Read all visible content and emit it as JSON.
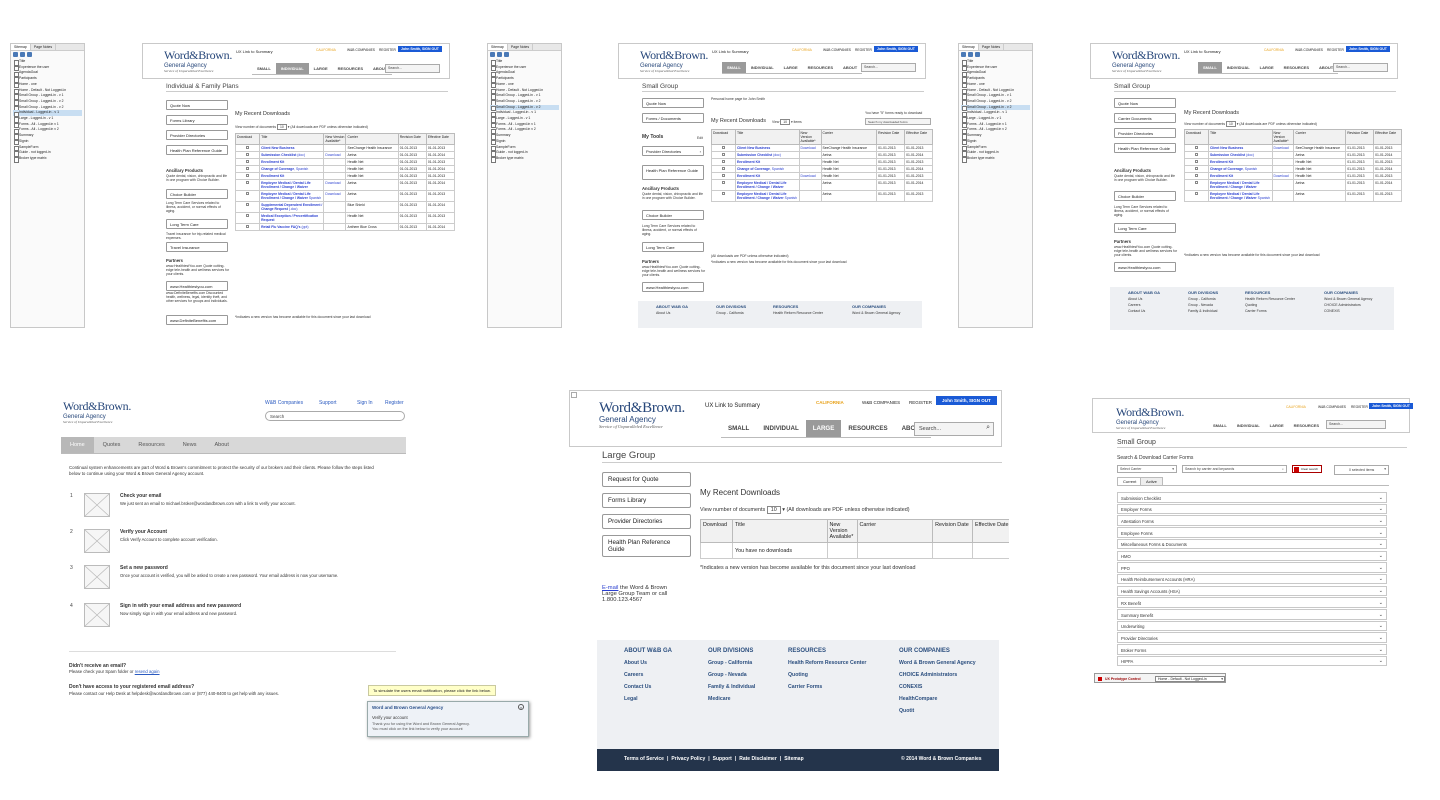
{
  "sitemap": {
    "tabs": [
      "Sitemap",
      "Page Notes"
    ],
    "items": [
      "Title",
      "Experience the user",
      "AgendaGoal",
      "Participants",
      "Home - one",
      "Home - Default - Not Logged-in",
      "Small Group - Logged-in - v 1",
      "Small Group - Logged-in - v 2",
      "Small Group - Logged-in - v 2",
      "Individual - Logged-in - v 1",
      "Large - Logged-in - v 1",
      "Forms - All - Logged-in v 1",
      "Forms - All - Logged-in v 2",
      "Summary",
      "Signin",
      "SampleForm",
      "Guide - not logged-in",
      "Broker type matrix"
    ],
    "selected_p1": "Individual - Logged-in - v 1",
    "selected_p2": "Small Group - Logged-in - v 2",
    "selected_p3": "Small Group - Logged-in - v 2"
  },
  "header": {
    "logo_line1": "Word&Brown.",
    "logo_line2": "General Agency",
    "logo_line3": "Service of Unparalleled Excellence",
    "ux_link": "UX  Link to Summary",
    "state": "CALIFORNIA",
    "companies": "W&B COMPANIES",
    "register": "REGISTER",
    "user_btn": "John Smith, SIGN OUT",
    "search_placeholder": "Search...",
    "nav": [
      "SMALL",
      "INDIVIDUAL",
      "LARGE",
      "RESOURCES",
      "ABOUT"
    ]
  },
  "panel1": {
    "title": "Individual & Family Plans",
    "side_buttons": [
      "Quote Now",
      "Forms Library",
      "Provider Directories",
      "Health Plan Reference Guide"
    ],
    "ancillary_title": "Ancillary Products",
    "ancillary_desc": "Quote dental, vision, chiropractic and life in one program with Choice Builder.",
    "choice_builder": "Choice Builder",
    "ltc_desc": "Long Term Care Services related to illness, accident, or normal effects of aging.",
    "ltc_btn": "Long Term Care",
    "travel_desc": "Travel insurance for trip-related medical expenses.",
    "travel_btn": "Travel Insurance",
    "partners_title": "Partners",
    "partners_desc": "www.HealthiestYou.com Quote cutting-edge tele-health and wellness services for your clients.",
    "partner_btn1": "www.Healthiestyou.com",
    "partners_desc2": "www.DefiniteBenefits.com Discounted health, wellness, legal, identity theft, and other services for groups and individuals.",
    "partner_btn2": "www.DefiniteBenefits.com",
    "downloads_title": "My Recent Downloads",
    "view_label": "View number of documents",
    "view_value": "10",
    "pdf_note": "(All downloads are PDF unless otherwise indicated)",
    "footnote": "*Indicates a new version has become available for this document since your last download"
  },
  "table_headers": [
    "Download",
    "Title",
    "New Version Available*",
    "Carrier",
    "Revision Date",
    "Effective Date"
  ],
  "rows_p1": [
    {
      "title": "Client New Business",
      "extra": "",
      "dl": "",
      "carrier": "SeeChange Health Insurance",
      "rev": "01-01-2013",
      "eff": "01-01-2013"
    },
    {
      "title": "Submission Checklist",
      "extra": " (doc)",
      "dl": "Download",
      "carrier": "Aetna",
      "rev": "01-01-2013",
      "eff": "01-01-2014"
    },
    {
      "title": "Enrollment Kit",
      "extra": "",
      "dl": "",
      "carrier": "Health Net",
      "rev": "01-01-2013",
      "eff": "01-01-2013"
    },
    {
      "title": "Change of Coverage",
      "extra": ", Spanish",
      "dl": "",
      "carrier": "Health Net",
      "rev": "01-01-2013",
      "eff": "01-01-2014"
    },
    {
      "title": "Enrollment Kit",
      "extra": "",
      "dl": "",
      "carrier": "Health Net",
      "rev": "01-01-2013",
      "eff": "01-01-2013"
    },
    {
      "title": "Employee Medical / Dental Life Enrollment / Change / Waiver",
      "extra": "",
      "dl": "Download",
      "carrier": "Aetna",
      "rev": "01-01-2013",
      "eff": "01-01-2014"
    },
    {
      "title": "Employee Medical / Dental Life Enrollment / Change / Waiver",
      "extra": " Spanish",
      "dl": "Download",
      "carrier": "Aetna",
      "rev": "01-01-2013",
      "eff": "01-01-2013"
    },
    {
      "title": "Supplemental Dependent Enrollment / Change Request",
      "extra": " (.doc)",
      "dl": "",
      "carrier": "Blue Shield",
      "rev": "01-01-2013",
      "eff": "01-01-2014"
    },
    {
      "title": "Medical Exception / Precertification Request",
      "extra": "",
      "dl": "",
      "carrier": "Health Net",
      "rev": "01-01-2013",
      "eff": "01-01-2013"
    },
    {
      "title": "Retail Flu Vaccine FAQ's",
      "extra": " (ppt)",
      "dl": "",
      "carrier": "Anthem Blue Cross",
      "rev": "01-01-2013",
      "eff": "01-01-2014"
    }
  ],
  "panel2": {
    "title": "Small Group",
    "personal": "Personal home page for John Smith",
    "forms_ready": "You have \"5\" forms ready to download",
    "search_downloads": "Search my downloaded forms",
    "side_buttons": [
      "Quote Now",
      "Forms / Documents"
    ],
    "my_tools": "My Tools",
    "edit": "Edit",
    "tool_buttons": [
      "Provider Directories",
      "Health Plan Reference Guide"
    ],
    "ancillary_title": "Ancillary Products",
    "ancillary_desc": "Quote dental, vision, chiropractic and life in one program with Choice Builder.",
    "choice_builder": "Choice Builder",
    "ltc_desc": "Long Term Care Services related to illness, accident, or normal effects of aging.",
    "ltc_btn": "Long Term Care",
    "partners_title": "Partners",
    "partners_desc": "www.HealthiestYou.com Quote cutting-edge tele-health and wellness services for your clients.",
    "partner_btn": "www.Healthiestyou.com",
    "downloads_title": "My Recent Downloads",
    "view_label": "View",
    "view_value": "10",
    "items_label": "items",
    "pdf_note": "(All downloads are PDF unless otherwise indicated)",
    "footnote": "*Indicates a new version has become available for this document since your last download"
  },
  "rows_p2": [
    {
      "title": "Client New Business",
      "extra": "",
      "dl": "Download",
      "carrier": "SeeChange Health Insurance",
      "rev": "01-01-2013",
      "eff": "01-01-2013"
    },
    {
      "title": "Submission Checklist",
      "extra": " (doc)",
      "dl": "",
      "carrier": "Aetna",
      "rev": "01-01-2013",
      "eff": "01-01-2014"
    },
    {
      "title": "Enrollment Kit",
      "extra": "",
      "dl": "",
      "carrier": "Health Net",
      "rev": "01-01-2013",
      "eff": "01-01-2013"
    },
    {
      "title": "Change of Coverage",
      "extra": ", Spanish",
      "dl": "",
      "carrier": "Health Net",
      "rev": "01-01-2013",
      "eff": "01-01-2014"
    },
    {
      "title": "Enrollment Kit",
      "extra": "",
      "dl": "Download",
      "carrier": "Health Net",
      "rev": "01-01-2013",
      "eff": "01-01-2013"
    },
    {
      "title": "Employee Medical / Dental Life Enrollment / Change / Waiver",
      "extra": "",
      "dl": "",
      "carrier": "Aetna",
      "rev": "01-01-2013",
      "eff": "01-01-2014"
    },
    {
      "title": "Employee Medical / Dental Life Enrollment / Change / Waiver",
      "extra": " Spanish",
      "dl": "",
      "carrier": "Aetna",
      "rev": "01-01-2013",
      "eff": "01-01-2013"
    }
  ],
  "panel3": {
    "title": "Small Group",
    "side_buttons": [
      "Quote Now",
      "Carrier Documents",
      "Provider Directories",
      "Health Plan Reference Guide"
    ],
    "ancillary_title": "Ancillary Products",
    "ancillary_desc": "Quote dental, vision, chiropractic and life in one program with Choice Builder.",
    "choice_builder": "Choice Builder",
    "ltc_desc": "Long Term Care Services related to illness, accident, or normal effects of aging.",
    "ltc_btn": "Long Term Care",
    "partners_title": "Partners",
    "partners_desc": "www.HealthiestYou.com Quote cutting-edge tele-health and wellness services for your clients.",
    "partner_btn": "www.Healthiestyou.com",
    "downloads_title": "My Recent Downloads",
    "view_label": "View number of documents",
    "view_value": "10",
    "pdf_note": "(All downloads are PDF unless otherwise indicated)",
    "footnote": "*Indicates a new version has become available for this document since your last download"
  },
  "rows_p3": [
    {
      "title": "Client New Business",
      "extra": "",
      "dl": "Download",
      "carrier": "SeeChange Health Insurance",
      "rev": "01-01-2013",
      "eff": "01-01-2013"
    },
    {
      "title": "Submission Checklist",
      "extra": " (doc)",
      "dl": "",
      "carrier": "Aetna",
      "rev": "01-01-2013",
      "eff": "01-01-2014"
    },
    {
      "title": "Enrollment Kit",
      "extra": "",
      "dl": "",
      "carrier": "Health Net",
      "rev": "01-01-2013",
      "eff": "01-01-2013"
    },
    {
      "title": "Change of Coverage",
      "extra": ", Spanish",
      "dl": "",
      "carrier": "Health Net",
      "rev": "01-01-2013",
      "eff": "01-01-2014"
    },
    {
      "title": "Enrollment Kit",
      "extra": "",
      "dl": "Download",
      "carrier": "Health Net",
      "rev": "01-01-2013",
      "eff": "01-01-2013"
    },
    {
      "title": "Employee Medical / Dental Life Enrollment / Change / Waiver",
      "extra": "",
      "dl": "",
      "carrier": "Aetna",
      "rev": "01-01-2013",
      "eff": "01-01-2014"
    },
    {
      "title": "Employee Medical / Dental Life Enrollment / Change / Waiver",
      "extra": " Spanish",
      "dl": "",
      "carrier": "Aetna",
      "rev": "01-01-2013",
      "eff": "01-01-2013"
    }
  ],
  "small_footer": {
    "cols": [
      {
        "h": "ABOUT W&B GA",
        "items": [
          "About Us",
          "Careers",
          "Contact Us"
        ]
      },
      {
        "h": "OUR DIVISIONS",
        "items": [
          "Group - California",
          "Group - Nevada",
          "Family & Individual"
        ]
      },
      {
        "h": "RESOURCES",
        "items": [
          "Health Reform Resource Center",
          "Quoting",
          "Carrier Forms"
        ]
      },
      {
        "h": "OUR COMPANIES",
        "items": [
          "Word & Brown General Agency",
          "CHOICE Administrators",
          "CONEXIS"
        ]
      }
    ]
  },
  "verify": {
    "top_links": [
      "W&B Companies",
      "Support",
      "Sign In",
      "Register"
    ],
    "search_placeholder": "Search",
    "nav": [
      "Home",
      "Quotes",
      "Resources",
      "News",
      "About"
    ],
    "intro": "Continual system enhancements are part of Word & Brown's commitment to protect the security of our brokers and their clients. Please follow the steps listed below to continue using your Word & Brown General Agency account.",
    "steps": [
      {
        "num": "1",
        "title": "Check your email",
        "desc": "We just sent an email to michael.broker@wordandbrown.com with a link to verify your account."
      },
      {
        "num": "2",
        "title": "Verify your Account",
        "desc": "Click Verify Account to complete account verification."
      },
      {
        "num": "3",
        "title": "Set a new password",
        "desc": "Once your account is verified, you will be asked to create a new password. Your email address is now your username."
      },
      {
        "num": "4",
        "title": "Sign in with your email address and new password",
        "desc": "Now simply sign in with your email address and new password."
      }
    ],
    "no_email_title": "Didn't receive an email?",
    "no_email_desc": "Please check your Spam folder or ",
    "resend": "resend again",
    "no_access_title": "Don't have access to your registered email address?",
    "no_access_desc": "Please contact our Help Desk at helpdesk@wordandbrown.com or (877) 440-8400 to get help with any issues.",
    "tooltip": "To simulate the users email notification, please click the link below.",
    "notif_title": "Word and Brown General Agency",
    "notif_subject": "Verify your account",
    "notif_body1": "Thank you for using the Word and Brown General Agency.",
    "notif_body2": "You must click on the link below to verify your account"
  },
  "large": {
    "title": "Large Group",
    "side_buttons": [
      "Request for Quote",
      "Forms Library",
      "Provider Directories",
      "Health Plan Reference Guide"
    ],
    "downloads_title": "My Recent Downloads",
    "view_label": "View number of documents",
    "view_value": "10",
    "pdf_note": "(All downloads are PDF unless otherwise indicated)",
    "empty": "You have no downloads",
    "footnote": "*Indicates a new version has become available for this document since your last download",
    "email_link": "E-mail",
    "contact1": " the Word & Brown",
    "contact2": "Large Group Team or call",
    "contact3": "1.800.123.4567",
    "footer_cols": [
      {
        "h": "ABOUT W&B GA",
        "items": [
          "About Us",
          "Careers",
          "Contact Us",
          "Legal"
        ]
      },
      {
        "h": "OUR DIVISIONS",
        "items": [
          "Group - California",
          "Group - Nevada",
          "Family & Individual",
          "Medicare"
        ]
      },
      {
        "h": "RESOURCES",
        "items": [
          "Health Reform Resource Center",
          "Quoting",
          "Carrier Forms"
        ]
      },
      {
        "h": "OUR COMPANIES",
        "items": [
          "Word & Brown General Agency",
          "CHOICE Administrators",
          "CONEXIS",
          "HealthCompare",
          "Quotit"
        ]
      }
    ],
    "bottom_links": [
      "Terms of Service",
      "Privacy Policy",
      "Support",
      "Rate Disclaimer",
      "Sitemap"
    ],
    "copyright": "© 2014 Word & Brown Companies"
  },
  "carrier": {
    "title": "Small Group",
    "search_title": "Search & Download Carrier Forms",
    "select_carrier": "Select Carrier",
    "search_placeholder": "Search by carrier and keywords",
    "clear_label": "Clear search",
    "selected_items": "0 selected items",
    "tabs": [
      "Current",
      "Active"
    ],
    "rows": [
      "Submission Checklist",
      "Employer Forms",
      "Attestation Forms",
      "Employee Forms",
      "Miscellaneous Forms & Documents",
      "HMO",
      "PPO",
      "Health Reimbursement Accounts (HRA)",
      "Health Savings Accounts (HSA)",
      "RX Benefit",
      "Summary Benefit",
      "Underwriting",
      "Provider Directories",
      "Broker Forms",
      "HIPPA"
    ],
    "proto_label": "UX Prototype Control",
    "proto_value": "Home - Default - Not Logged-in"
  }
}
